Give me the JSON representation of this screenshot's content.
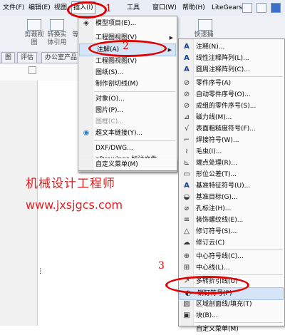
{
  "menubar": {
    "items": [
      {
        "label": "文件(F)"
      },
      {
        "label": "编辑(E)"
      },
      {
        "label": "视图"
      },
      {
        "label": "插入(I)"
      },
      {
        "label": "工具"
      },
      {
        "label": "窗口(W)"
      },
      {
        "label": "帮助(H)"
      },
      {
        "label": "LiteGears"
      }
    ]
  },
  "toolbar": {
    "left_caption_1": "剪裁视",
    "left_caption_2": "图",
    "mid_caption_1": "转换实",
    "mid_caption_2": "体引用",
    "side_caption": "等",
    "right_caption_1": "快速捕",
    "right_caption_2": "捉"
  },
  "tabs": [
    {
      "label": "图"
    },
    {
      "label": "评估"
    },
    {
      "label": "办公室产品"
    }
  ],
  "panel_collapse": "»",
  "insert_menu": {
    "items": [
      {
        "label": "模型项目(E)...",
        "icon": "model-items-icon"
      },
      {
        "label": "工程图视图(V)",
        "icon": "",
        "submenu": true
      },
      {
        "label": "注解(A)",
        "icon": "",
        "submenu": true,
        "highlight": true
      },
      {
        "label": "工程图视图(V)",
        "icon": ""
      },
      {
        "label": "图纸(S)...",
        "icon": ""
      },
      {
        "label": "制作剖切线(M)",
        "icon": ""
      },
      {
        "label": "对象(O)...",
        "icon": ""
      },
      {
        "label": "图片(P)...",
        "icon": ""
      },
      {
        "label": "图框(C)...",
        "icon": "",
        "disabled": true
      },
      {
        "label": "超文本链接(Y)...",
        "icon": "hyperlink-icon"
      },
      {
        "label": "DXF/DWG...",
        "icon": ""
      },
      {
        "label": "eDrawings 标注文件",
        "icon": ""
      },
      {
        "label": "自定义菜单(M)",
        "icon": ""
      }
    ]
  },
  "annotation_menu": {
    "items": [
      {
        "label": "注释(N)...",
        "glyph": "A"
      },
      {
        "label": "线性注释阵列(L)...",
        "glyph": "A"
      },
      {
        "label": "圆周注释阵列(C)...",
        "glyph": "A"
      },
      {
        "label": "零件序号(A)",
        "glyph": "⊘"
      },
      {
        "label": "自动零件序号(O)...",
        "glyph": "⊘"
      },
      {
        "label": "成组的零件序号(S)...",
        "glyph": "⊘"
      },
      {
        "label": "磁力线(M)...",
        "glyph": "⊿"
      },
      {
        "label": "表面粗糙度符号(F)...",
        "glyph": "√"
      },
      {
        "label": "焊接符号(W)...",
        "glyph": "⌐"
      },
      {
        "label": "毛虫(I)...",
        "glyph": "≀"
      },
      {
        "label": "端点处理(R)...",
        "glyph": "⊾"
      },
      {
        "label": "形位公差(T)...",
        "glyph": "▭"
      },
      {
        "label": "基准特征符号(U)...",
        "glyph": "A"
      },
      {
        "label": "基准目标(G)...",
        "glyph": "◒"
      },
      {
        "label": "孔标注(H)...",
        "glyph": "⌀"
      },
      {
        "label": "装饰螺纹线(E)...",
        "glyph": "≡"
      },
      {
        "label": "修订符号(S)...",
        "glyph": "△"
      },
      {
        "label": "修订云(C)",
        "glyph": "☁"
      },
      {
        "label": "中心符号线(C)...",
        "glyph": "⊕"
      },
      {
        "label": "中心线(L)...",
        "glyph": "⊞"
      },
      {
        "label": "多转折引线(U)",
        "glyph": "↗"
      },
      {
        "label": "销钉符号(P)",
        "glyph": "◐",
        "highlight": true
      },
      {
        "label": "区域剖面线/填充(T)",
        "glyph": "▨"
      },
      {
        "label": "块(B)...",
        "glyph": "▣"
      },
      {
        "label": "自定义菜单(M)",
        "glyph": ""
      }
    ]
  },
  "callouts": [
    "1",
    "2",
    "3"
  ],
  "watermark": {
    "line1": "机械设计工程师",
    "line2": "www.jxsjgcs.com",
    "color": "#e02020"
  },
  "colors": {
    "callout_red": "#e00000",
    "menu_highlight": "#d5e4f7"
  }
}
